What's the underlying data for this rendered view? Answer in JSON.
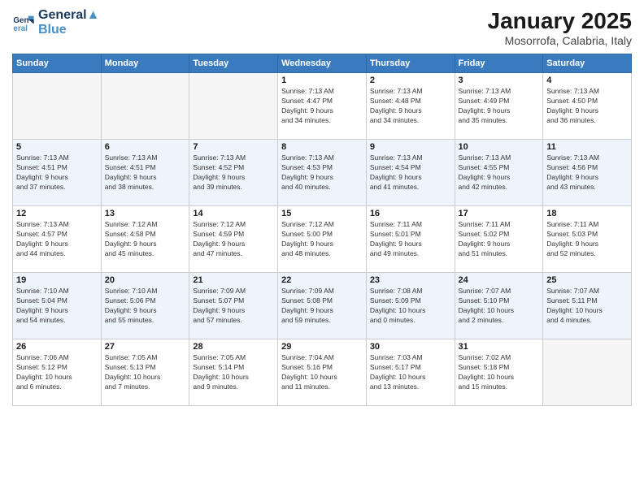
{
  "logo": {
    "line1": "General",
    "line2": "Blue"
  },
  "title": "January 2025",
  "subtitle": "Mosorrofa, Calabria, Italy",
  "headers": [
    "Sunday",
    "Monday",
    "Tuesday",
    "Wednesday",
    "Thursday",
    "Friday",
    "Saturday"
  ],
  "weeks": [
    {
      "days": [
        {
          "num": "",
          "text": ""
        },
        {
          "num": "",
          "text": ""
        },
        {
          "num": "",
          "text": ""
        },
        {
          "num": "1",
          "text": "Sunrise: 7:13 AM\nSunset: 4:47 PM\nDaylight: 9 hours\nand 34 minutes."
        },
        {
          "num": "2",
          "text": "Sunrise: 7:13 AM\nSunset: 4:48 PM\nDaylight: 9 hours\nand 34 minutes."
        },
        {
          "num": "3",
          "text": "Sunrise: 7:13 AM\nSunset: 4:49 PM\nDaylight: 9 hours\nand 35 minutes."
        },
        {
          "num": "4",
          "text": "Sunrise: 7:13 AM\nSunset: 4:50 PM\nDaylight: 9 hours\nand 36 minutes."
        }
      ]
    },
    {
      "days": [
        {
          "num": "5",
          "text": "Sunrise: 7:13 AM\nSunset: 4:51 PM\nDaylight: 9 hours\nand 37 minutes."
        },
        {
          "num": "6",
          "text": "Sunrise: 7:13 AM\nSunset: 4:51 PM\nDaylight: 9 hours\nand 38 minutes."
        },
        {
          "num": "7",
          "text": "Sunrise: 7:13 AM\nSunset: 4:52 PM\nDaylight: 9 hours\nand 39 minutes."
        },
        {
          "num": "8",
          "text": "Sunrise: 7:13 AM\nSunset: 4:53 PM\nDaylight: 9 hours\nand 40 minutes."
        },
        {
          "num": "9",
          "text": "Sunrise: 7:13 AM\nSunset: 4:54 PM\nDaylight: 9 hours\nand 41 minutes."
        },
        {
          "num": "10",
          "text": "Sunrise: 7:13 AM\nSunset: 4:55 PM\nDaylight: 9 hours\nand 42 minutes."
        },
        {
          "num": "11",
          "text": "Sunrise: 7:13 AM\nSunset: 4:56 PM\nDaylight: 9 hours\nand 43 minutes."
        }
      ]
    },
    {
      "days": [
        {
          "num": "12",
          "text": "Sunrise: 7:13 AM\nSunset: 4:57 PM\nDaylight: 9 hours\nand 44 minutes."
        },
        {
          "num": "13",
          "text": "Sunrise: 7:12 AM\nSunset: 4:58 PM\nDaylight: 9 hours\nand 45 minutes."
        },
        {
          "num": "14",
          "text": "Sunrise: 7:12 AM\nSunset: 4:59 PM\nDaylight: 9 hours\nand 47 minutes."
        },
        {
          "num": "15",
          "text": "Sunrise: 7:12 AM\nSunset: 5:00 PM\nDaylight: 9 hours\nand 48 minutes."
        },
        {
          "num": "16",
          "text": "Sunrise: 7:11 AM\nSunset: 5:01 PM\nDaylight: 9 hours\nand 49 minutes."
        },
        {
          "num": "17",
          "text": "Sunrise: 7:11 AM\nSunset: 5:02 PM\nDaylight: 9 hours\nand 51 minutes."
        },
        {
          "num": "18",
          "text": "Sunrise: 7:11 AM\nSunset: 5:03 PM\nDaylight: 9 hours\nand 52 minutes."
        }
      ]
    },
    {
      "days": [
        {
          "num": "19",
          "text": "Sunrise: 7:10 AM\nSunset: 5:04 PM\nDaylight: 9 hours\nand 54 minutes."
        },
        {
          "num": "20",
          "text": "Sunrise: 7:10 AM\nSunset: 5:06 PM\nDaylight: 9 hours\nand 55 minutes."
        },
        {
          "num": "21",
          "text": "Sunrise: 7:09 AM\nSunset: 5:07 PM\nDaylight: 9 hours\nand 57 minutes."
        },
        {
          "num": "22",
          "text": "Sunrise: 7:09 AM\nSunset: 5:08 PM\nDaylight: 9 hours\nand 59 minutes."
        },
        {
          "num": "23",
          "text": "Sunrise: 7:08 AM\nSunset: 5:09 PM\nDaylight: 10 hours\nand 0 minutes."
        },
        {
          "num": "24",
          "text": "Sunrise: 7:07 AM\nSunset: 5:10 PM\nDaylight: 10 hours\nand 2 minutes."
        },
        {
          "num": "25",
          "text": "Sunrise: 7:07 AM\nSunset: 5:11 PM\nDaylight: 10 hours\nand 4 minutes."
        }
      ]
    },
    {
      "days": [
        {
          "num": "26",
          "text": "Sunrise: 7:06 AM\nSunset: 5:12 PM\nDaylight: 10 hours\nand 6 minutes."
        },
        {
          "num": "27",
          "text": "Sunrise: 7:05 AM\nSunset: 5:13 PM\nDaylight: 10 hours\nand 7 minutes."
        },
        {
          "num": "28",
          "text": "Sunrise: 7:05 AM\nSunset: 5:14 PM\nDaylight: 10 hours\nand 9 minutes."
        },
        {
          "num": "29",
          "text": "Sunrise: 7:04 AM\nSunset: 5:16 PM\nDaylight: 10 hours\nand 11 minutes."
        },
        {
          "num": "30",
          "text": "Sunrise: 7:03 AM\nSunset: 5:17 PM\nDaylight: 10 hours\nand 13 minutes."
        },
        {
          "num": "31",
          "text": "Sunrise: 7:02 AM\nSunset: 5:18 PM\nDaylight: 10 hours\nand 15 minutes."
        },
        {
          "num": "",
          "text": ""
        }
      ]
    }
  ]
}
